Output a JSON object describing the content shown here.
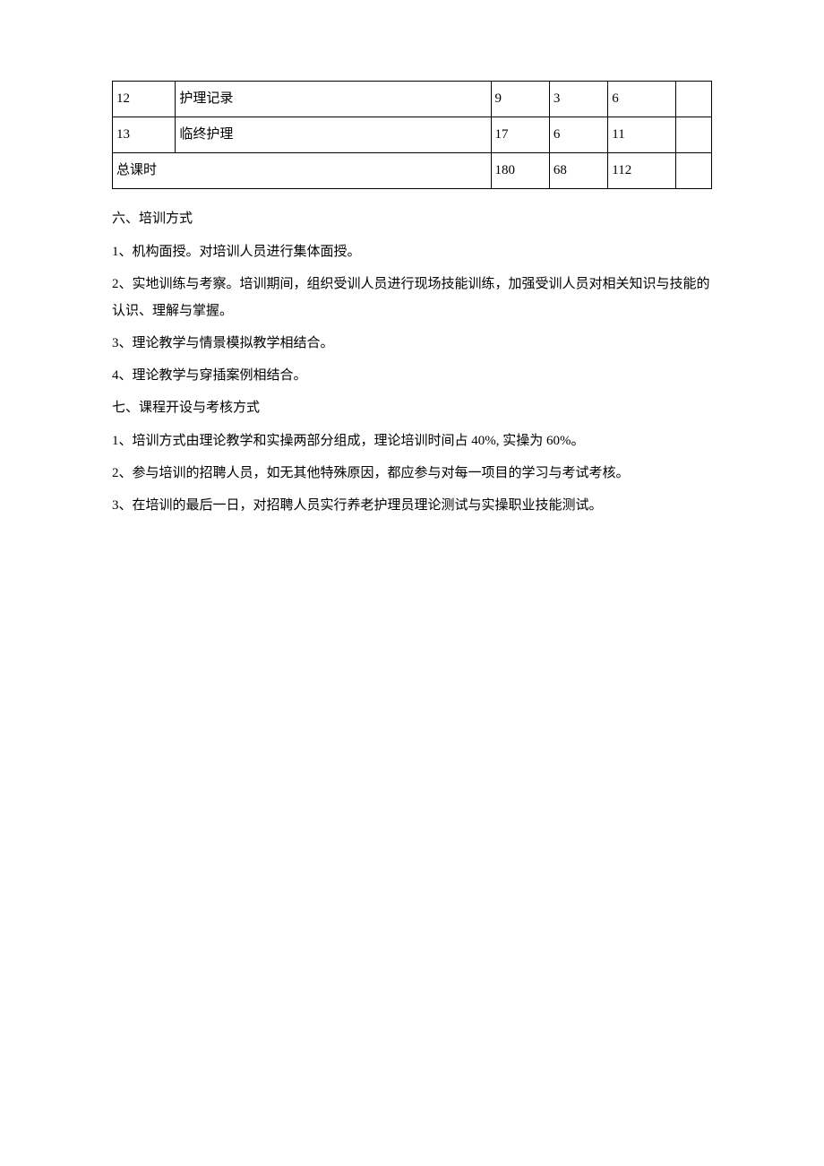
{
  "table": {
    "rows": [
      {
        "num": "12",
        "name": "护理记录",
        "c3": "9",
        "c4": "3",
        "c5": "6",
        "c6": ""
      },
      {
        "num": "13",
        "name": "临终护理",
        "c3": "17",
        "c4": "6",
        "c5": "11",
        "c6": ""
      }
    ],
    "total": {
      "label": "总课时",
      "c3": "180",
      "c4": "68",
      "c5": "112",
      "c6": ""
    }
  },
  "sections": {
    "s6_title": "六、培训方式",
    "s6_items": [
      "1、机构面授。对培训人员进行集体面授。",
      "2、实地训练与考察。培训期间，组织受训人员进行现场技能训练，加强受训人员对相关知识与技能的认识、理解与掌握。",
      "3、理论教学与情景模拟教学相结合。",
      "4、理论教学与穿插案例相结合。"
    ],
    "s7_title": "七、课程开设与考核方式",
    "s7_items": [
      "1、培训方式由理论教学和实操两部分组成，理论培训时间占 40%, 实操为 60%。",
      "2、参与培训的招聘人员，如无其他特殊原因，都应参与对每一项目的学习与考试考核。",
      "3、在培训的最后一日，对招聘人员实行养老护理员理论测试与实操职业技能测试。"
    ]
  }
}
